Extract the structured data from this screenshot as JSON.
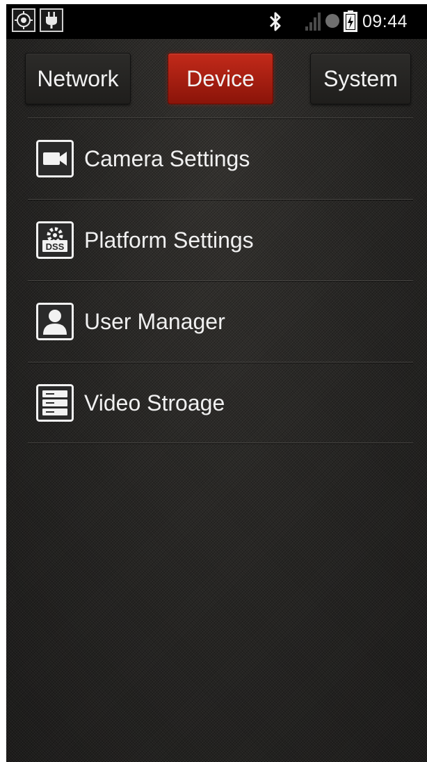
{
  "status_bar": {
    "time": "09:44",
    "icons": [
      "gps-target-icon",
      "power-plug-icon",
      "bluetooth-icon",
      "signal-bars-icon",
      "status-dot-icon",
      "battery-charging-icon"
    ]
  },
  "tabs": [
    {
      "label": "Network",
      "active": false
    },
    {
      "label": "Device",
      "active": true
    },
    {
      "label": "System",
      "active": false
    }
  ],
  "menu": {
    "items": [
      {
        "label": "Camera Settings",
        "icon": "camera-icon"
      },
      {
        "label": "Platform Settings",
        "icon": "dss-platform-icon",
        "icon_text": "DSS"
      },
      {
        "label": "User Manager",
        "icon": "user-icon"
      },
      {
        "label": "Video Stroage",
        "icon": "storage-icon"
      }
    ]
  },
  "colors": {
    "active_tab": "#b3200f",
    "background": "#262523",
    "text": "#f0f0f0"
  }
}
